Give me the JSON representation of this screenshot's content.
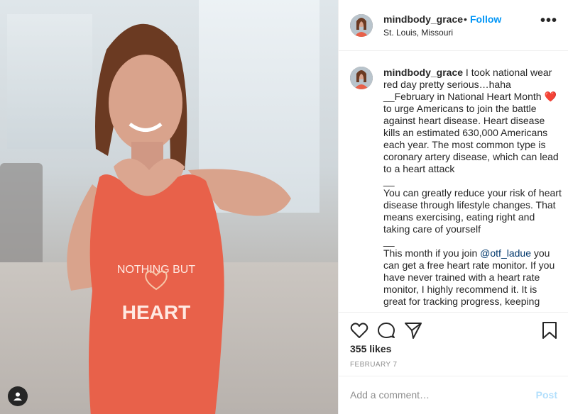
{
  "post": {
    "username": "mindbody_grace",
    "separator": "•",
    "follow_label": "Follow",
    "location": "St. Louis, Missouri",
    "more_label": "•••",
    "shirt_top": "NOTHING BUT",
    "shirt_bottom": "HEART"
  },
  "caption": {
    "username": "mindbody_grace",
    "p1": " I took national wear red day pretty serious…haha\n__February in National Heart Month ❤️ to urge Americans to join the battle against heart disease. Heart disease kills an estimated 630,000 Americans each year. The most common type is coronary artery disease, which can lead to a heart attack\n__\nYou can greatly reduce your risk of heart disease through lifestyle changes. That means exercising, eating right and taking care of yourself\n__\nThis month if you join ",
    "mention": "@otf_ladue",
    "p2": " you can get a free heart rate monitor. If you have never trained with a heart rate monitor, I highly recommend it. It is great for tracking progress, keeping"
  },
  "stats": {
    "likes": "355 likes",
    "date": "FEBRUARY 7"
  },
  "comment": {
    "placeholder": "Add a comment…",
    "post_label": "Post"
  },
  "colors": {
    "accent": "#0095f6",
    "post_disabled": "#b2dffc",
    "shirt": "#e8614a"
  },
  "icons": [
    "heart-icon",
    "comment-icon",
    "share-icon",
    "bookmark-icon",
    "user-tag-icon",
    "more-icon"
  ]
}
